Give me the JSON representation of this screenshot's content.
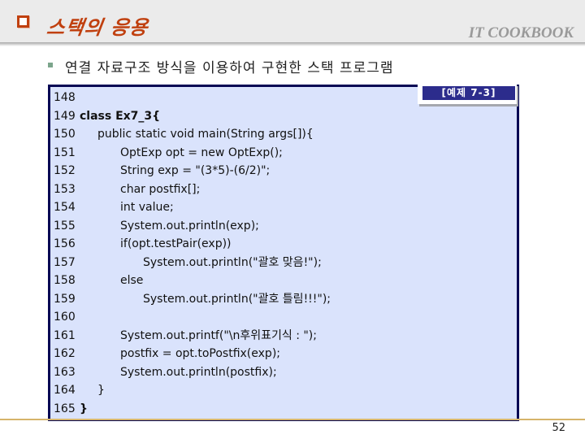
{
  "header": {
    "title": "스택의 응용",
    "brand": "IT COOKBOOK"
  },
  "bullet": {
    "text": "연결 자료구조 방식을 이용하여 구현한 스택 프로그램"
  },
  "example_tag": "[예제 7-3]",
  "code": {
    "lines": [
      {
        "num": "148",
        "text": ""
      },
      {
        "num": "149",
        "text": "class Ex7_3{"
      },
      {
        "num": "150",
        "text": "public static void main(String args[]){"
      },
      {
        "num": "151",
        "text": "OptExp opt = new OptExp();"
      },
      {
        "num": "152",
        "text": "String exp = \"(3*5)-(6/2)\";"
      },
      {
        "num": "153",
        "text": "char postfix[];"
      },
      {
        "num": "154",
        "text": "int value;"
      },
      {
        "num": "155",
        "text": "System.out.println(exp);"
      },
      {
        "num": "156",
        "text": "if(opt.testPair(exp))"
      },
      {
        "num": "157",
        "text": "System.out.println(\"괄호 맞음!\");"
      },
      {
        "num": "158",
        "text": "else"
      },
      {
        "num": "159",
        "text": "System.out.println(\"괄호 틀림!!!\");"
      },
      {
        "num": "160",
        "text": ""
      },
      {
        "num": "161",
        "text": "System.out.printf(\"\\n후위표기식 : \");"
      },
      {
        "num": "162",
        "text": "postfix = opt.toPostfix(exp);"
      },
      {
        "num": "163",
        "text": "System.out.println(postfix);"
      },
      {
        "num": "164",
        "text": "}"
      },
      {
        "num": "165",
        "text": "}"
      }
    ]
  },
  "footer": {
    "page_number": "52"
  }
}
